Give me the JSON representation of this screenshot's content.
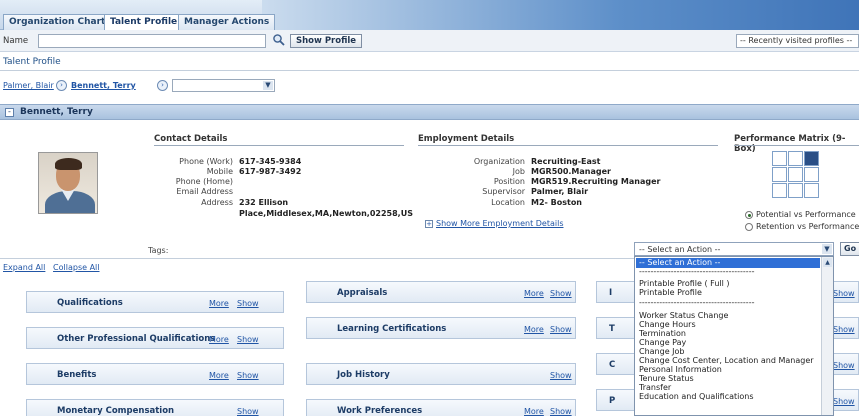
{
  "tabs": [
    {
      "label": "Organization Chart"
    },
    {
      "label": "Talent Profile"
    },
    {
      "label": "Manager Actions"
    }
  ],
  "search": {
    "label": "Name",
    "value": "",
    "button": "Show Profile",
    "recent": "-- Recently visited profiles --"
  },
  "section_title": "Talent Profile",
  "breadcrumb": {
    "items": [
      "Palmer, Blair",
      "Bennett, Terry"
    ],
    "select_value": ""
  },
  "person": {
    "name": "Bennett, Terry"
  },
  "contact": {
    "header": "Contact Details",
    "fields": [
      {
        "label": "Phone (Work)",
        "value": "617-345-9384"
      },
      {
        "label": "Mobile",
        "value": "617-987-3492"
      },
      {
        "label": "Phone (Home)",
        "value": ""
      },
      {
        "label": "Email Address",
        "value": ""
      },
      {
        "label": "Address",
        "value": "232 Ellison"
      }
    ],
    "address_line2": "Place,Middlesex,MA,Newton,02258,US"
  },
  "employment": {
    "header": "Employment Details",
    "fields": [
      {
        "label": "Organization",
        "value": "Recruiting-East"
      },
      {
        "label": "Job",
        "value": "MGR500.Manager"
      },
      {
        "label": "Position",
        "value": "MGR519.Recruiting Manager"
      },
      {
        "label": "Supervisor",
        "value": "Palmer, Blair"
      },
      {
        "label": "Location",
        "value": "M2- Boston"
      }
    ],
    "more_link": "Show More Employment Details"
  },
  "performance": {
    "header": "Performance Matrix (9-Box)",
    "highlighted_cell": "row 1, column 3",
    "options": [
      {
        "label": "Potential vs Performance",
        "selected": true
      },
      {
        "label": "Retention vs Performance",
        "selected": false
      }
    ]
  },
  "tags_label": "Tags:",
  "action": {
    "selected": "-- Select an Action --",
    "go": "Go",
    "options": [
      "-- Select an Action --",
      "----------------------------------------",
      "Printable Profile ( Full )",
      "Printable Profile",
      "----------------------------------------",
      "Worker Status Change",
      "Change Hours",
      "Termination",
      "Change Pay",
      "Change Job",
      "Change Cost Center, Location and Manager",
      "Personal Information",
      "Tenure Status",
      "Transfer",
      "Education and Qualifications"
    ]
  },
  "expand_all": "Expand All",
  "collapse_all": "Collapse All",
  "panels": {
    "left": [
      {
        "title": "Qualifications",
        "more": "More",
        "show": "Show"
      },
      {
        "title": "Other Professional Qualifications",
        "more": "More",
        "show": "Show"
      },
      {
        "title": "Benefits",
        "more": "More",
        "show": "Show"
      },
      {
        "title": "Monetary Compensation",
        "more": "",
        "show": "Show"
      }
    ],
    "middle": [
      {
        "title": "Appraisals",
        "more": "More",
        "show": "Show"
      },
      {
        "title": "Learning Certifications",
        "more": "More",
        "show": "Show"
      },
      {
        "title": "Job History",
        "more": "",
        "show": "Show"
      },
      {
        "title": "Work Preferences",
        "more": "More",
        "show": "Show"
      }
    ],
    "right_visible": [
      "Show",
      "Show",
      "Show",
      "Show"
    ],
    "right_fragments": [
      "I",
      "T",
      "C",
      "P"
    ]
  }
}
